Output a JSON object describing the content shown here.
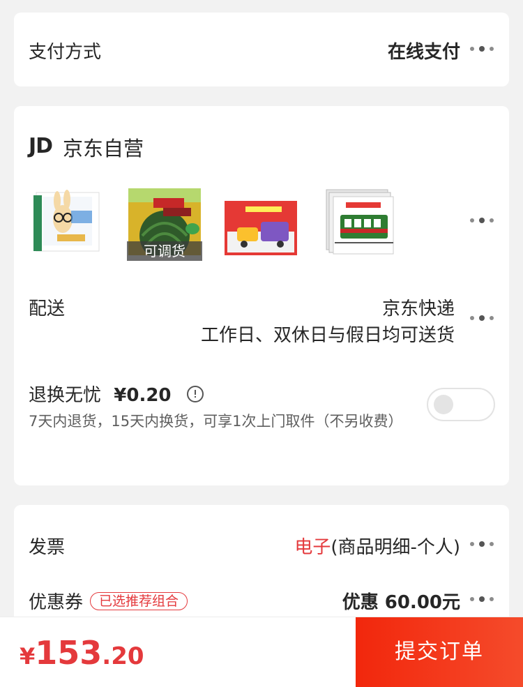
{
  "payment": {
    "label": "支付方式",
    "value": "在线支付"
  },
  "shop": {
    "logo": "JD",
    "name": "京东自营"
  },
  "products": [
    {
      "name": "book-1",
      "tag": ""
    },
    {
      "name": "book-2",
      "tag": "可调货"
    },
    {
      "name": "book-3",
      "tag": ""
    },
    {
      "name": "book-4",
      "tag": ""
    }
  ],
  "delivery": {
    "label": "配送",
    "carrier": "京东快递",
    "schedule": "工作日、双休日与假日均可送货"
  },
  "return_service": {
    "label": "退换无忧",
    "price": "¥0.20",
    "description": "7天内退货，15天内换货，可享1次上门取件（不另收费）",
    "enabled": false
  },
  "invoice": {
    "label": "发票",
    "type": "电子",
    "detail": "(商品明细-个人)"
  },
  "coupon": {
    "label": "优惠券",
    "badge": "已选推荐组合",
    "value": "优惠 60.00元"
  },
  "total": {
    "symbol": "¥",
    "integer": "153",
    "decimal": ".20"
  },
  "submit_label": "提交订单",
  "colors": {
    "accent": "#e4393c",
    "submit_start": "#f2270c",
    "submit_end": "#f54b2b"
  }
}
